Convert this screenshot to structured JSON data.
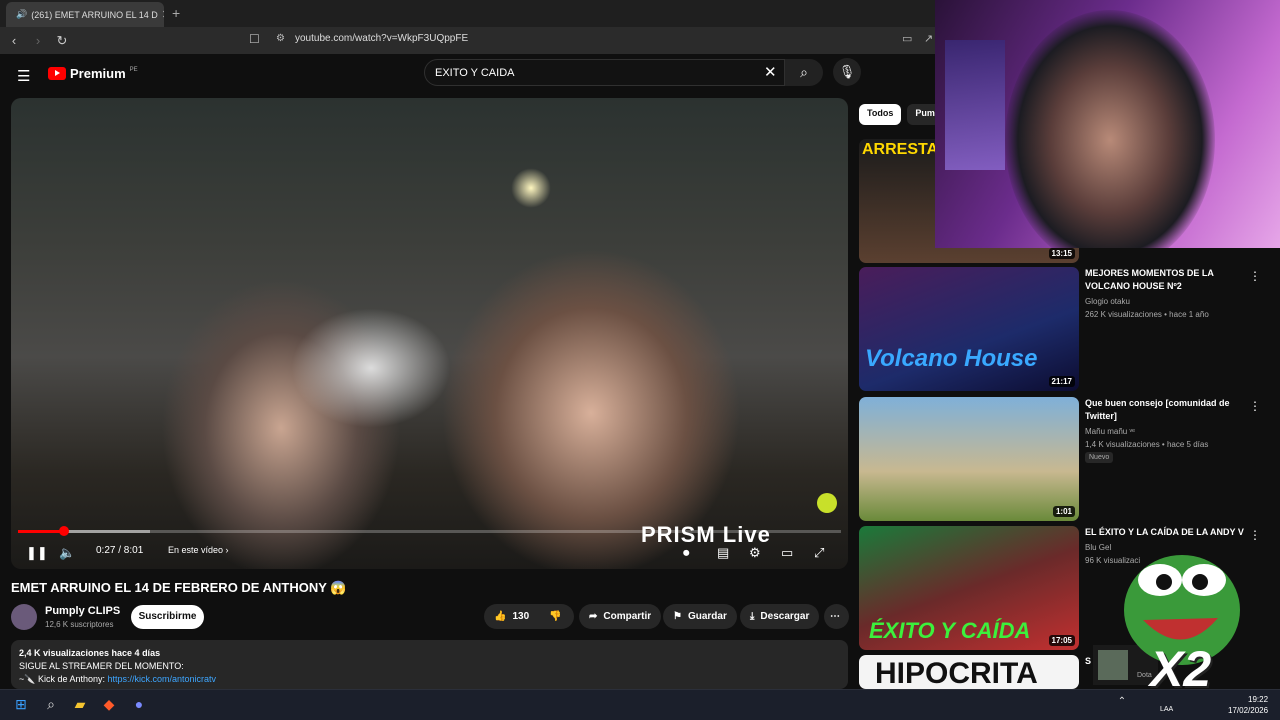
{
  "browser": {
    "tab_title": "(261) EMET ARRUINO EL 14 D",
    "tab_close": "✕",
    "new_tab": "+",
    "url": "youtube.com/watch?v=WkpF3UQppFE"
  },
  "youtube": {
    "logo": "Premium",
    "country": "PE",
    "search_value": "EXITO Y CAIDA"
  },
  "player": {
    "time": "0:27 / 8:01",
    "chapter": "En este vídeo  ›",
    "watermark": "PRISM Live",
    "progress": 0.056,
    "buffered": 0.16
  },
  "video": {
    "title": "EMET ARRUINO EL 14 DE FEBRERO DE ANTHONY 😱",
    "channel": "Pumply CLIPS",
    "subscribers": "12,6 K suscriptores",
    "subscribe": "Suscribirme",
    "likes": "130",
    "share": "Compartir",
    "save": "Guardar",
    "download": "Descargar",
    "views": "2,4 K visualizaciones  hace 4 días",
    "desc_line1": "SIGUE AL STREAMER DEL MOMENTO:",
    "desc_line2": "~🔪 Kick de Anthony: ",
    "desc_link": "https://kick.com/antonicratv"
  },
  "sidebar": {
    "chip_all": "Todos",
    "chip_2": "Pumply",
    "items": [
      {
        "title": "ARRESTA",
        "duration": "13:15"
      },
      {
        "title": "MEJORES MOMENTOS DE LA VOLCANO HOUSE Nº2",
        "channel": "Glogio otaku",
        "meta": "262 K visualizaciones • hace 1 año",
        "duration": "21:17",
        "thumb_text": "Volcano House"
      },
      {
        "title": "Que buen consejo [comunidad de Twitter]",
        "channel": "Mañu mañu ᵛᵉ",
        "meta": "1,4 K visualizaciones • hace 5 días",
        "badge": "Nuevo",
        "duration": "1:01"
      },
      {
        "title": "EL ÉXITO Y LA CAÍDA DE LA ANDY V",
        "channel": "Blu Gel",
        "meta": "96 K visualizaci",
        "duration": "17:05",
        "thumb_text": "ÉXITO Y CAÍDA"
      },
      {
        "title": "S",
        "thumb_text": "HIPOCRITA"
      }
    ]
  },
  "overlay": {
    "x2": "X2",
    "notif_text": "Dota"
  },
  "taskbar": {
    "lang": "LAA",
    "time": "19:22",
    "date": "17/02/2026"
  }
}
